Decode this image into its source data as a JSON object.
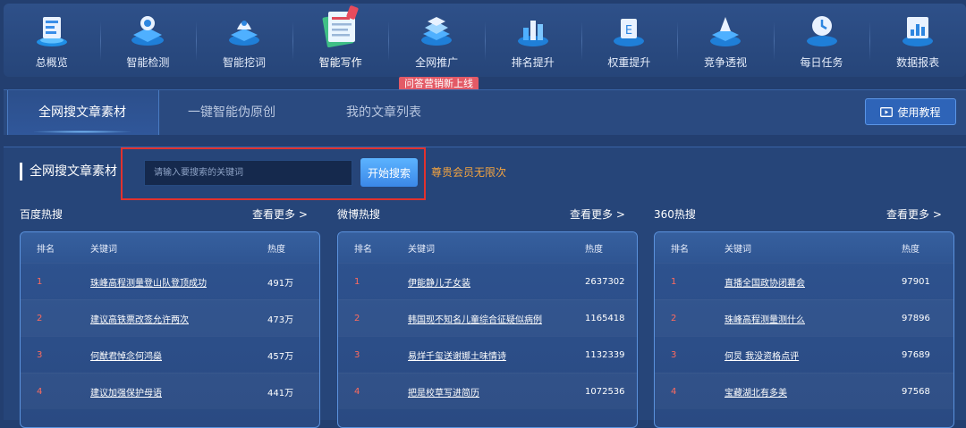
{
  "nav": {
    "items": [
      {
        "label": "总概览",
        "icon": "overview-icon"
      },
      {
        "label": "智能检测",
        "icon": "detect-icon"
      },
      {
        "label": "智能挖词",
        "icon": "dig-words-icon"
      },
      {
        "label": "智能写作",
        "icon": "writing-icon",
        "active": true
      },
      {
        "label": "全网推广",
        "icon": "promotion-icon"
      },
      {
        "label": "排名提升",
        "icon": "ranking-icon"
      },
      {
        "label": "权重提升",
        "icon": "weight-icon"
      },
      {
        "label": "竞争透视",
        "icon": "competition-icon"
      },
      {
        "label": "每日任务",
        "icon": "daily-task-icon"
      },
      {
        "label": "数据报表",
        "icon": "report-icon"
      }
    ],
    "badge": "问答营销新上线"
  },
  "tabs": [
    {
      "label": "全网搜文章素材",
      "active": true
    },
    {
      "label": "一键智能伪原创"
    },
    {
      "label": "我的文章列表"
    }
  ],
  "tutorial_label": "使用教程",
  "search": {
    "section_title": "全网搜文章素材",
    "placeholder": "请输入要搜索的关键词",
    "button": "开始搜索",
    "vip_note": "尊贵会员无限次"
  },
  "hot_columns": [
    {
      "title": "百度热搜",
      "more": "查看更多 >",
      "headers": {
        "rank": "排名",
        "keyword": "关键词",
        "heat": "热度"
      },
      "rows": [
        {
          "rank": "1",
          "keyword": "珠峰高程测量登山队登顶成功",
          "heat": "491万"
        },
        {
          "rank": "2",
          "keyword": "建议高铁票改签允许两次",
          "heat": "473万"
        },
        {
          "rank": "3",
          "keyword": "何猷君悼念何鸿燊",
          "heat": "457万"
        },
        {
          "rank": "4",
          "keyword": "建议加强保护母语",
          "heat": "441万"
        }
      ]
    },
    {
      "title": "微博热搜",
      "more": "查看更多 >",
      "headers": {
        "rank": "排名",
        "keyword": "关键词",
        "heat": "热度"
      },
      "rows": [
        {
          "rank": "1",
          "keyword": "伊能静儿子女装",
          "heat": "2637302"
        },
        {
          "rank": "2",
          "keyword": "韩国现不知名儿童综合征疑似病例",
          "heat": "1165418"
        },
        {
          "rank": "3",
          "keyword": "易烊千玺送谢娜土味情诗",
          "heat": "1132339"
        },
        {
          "rank": "4",
          "keyword": "把是校草写进简历",
          "heat": "1072536"
        }
      ]
    },
    {
      "title": "360热搜",
      "more": "查看更多 >",
      "headers": {
        "rank": "排名",
        "keyword": "关键词",
        "heat": "热度"
      },
      "rows": [
        {
          "rank": "1",
          "keyword": "直播全国政协闭幕会",
          "heat": "97901"
        },
        {
          "rank": "2",
          "keyword": "珠峰高程测量测什么",
          "heat": "97896"
        },
        {
          "rank": "3",
          "keyword": "何炅 我没资格点评",
          "heat": "97689"
        },
        {
          "rank": "4",
          "keyword": "宝藏湖北有多美",
          "heat": "97568"
        }
      ]
    }
  ]
}
